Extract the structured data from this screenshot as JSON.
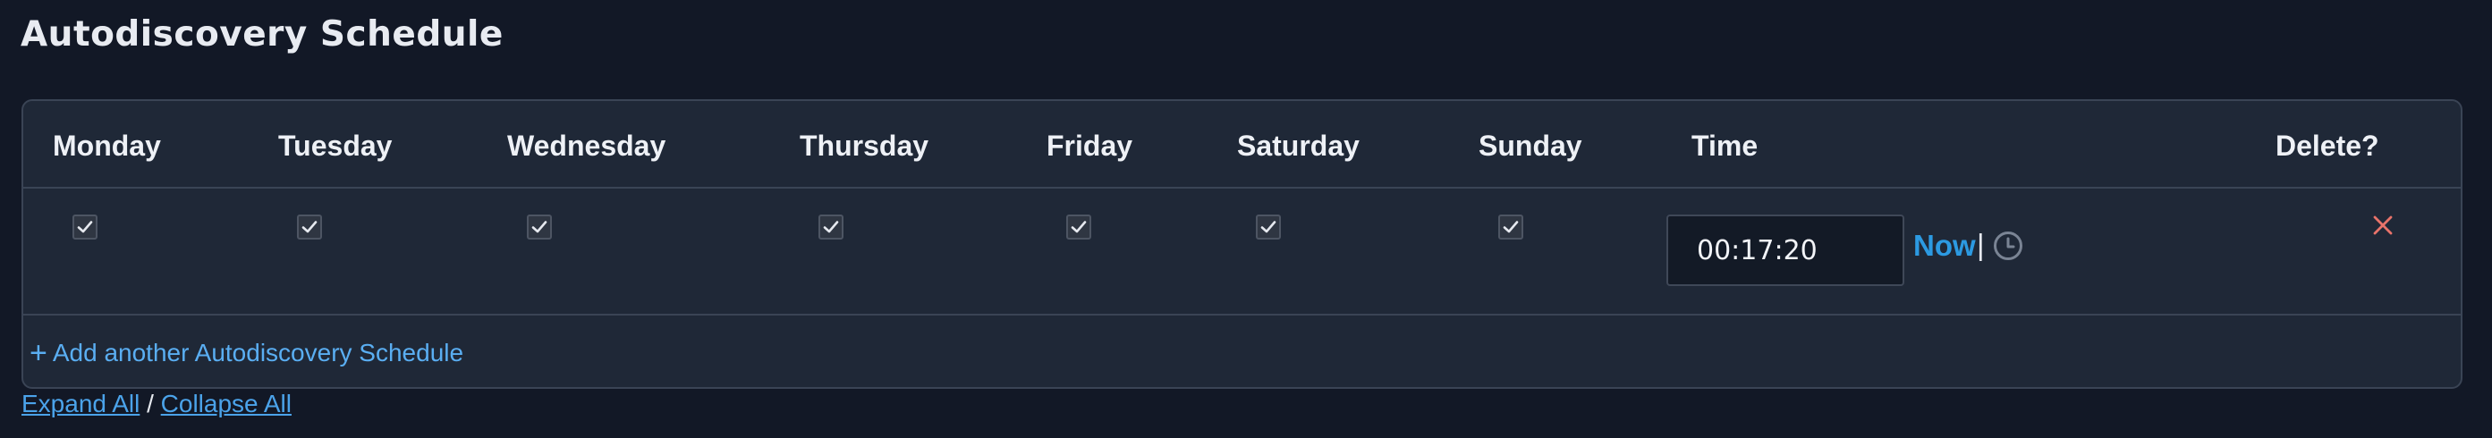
{
  "page": {
    "title": "Autodiscovery Schedule"
  },
  "table": {
    "columns": [
      "Monday",
      "Tuesday",
      "Wednesday",
      "Thursday",
      "Friday",
      "Saturday",
      "Sunday",
      "Time",
      "Delete?"
    ],
    "rows": [
      {
        "days": {
          "monday": true,
          "tuesday": true,
          "wednesday": true,
          "thursday": true,
          "friday": true,
          "saturday": true,
          "sunday": true
        },
        "time_value": "00:17:20",
        "now_label": "Now",
        "separator": "|",
        "clock_icon": "clock-icon",
        "delete_icon": "close-icon"
      }
    ]
  },
  "add_link": {
    "plus": "+",
    "label": "Add another Autodiscovery Schedule"
  },
  "footer": {
    "expand_all": "Expand All",
    "separator": "/",
    "collapse_all": "Collapse All"
  },
  "colors": {
    "background": "#121826",
    "panel": "#1f2837",
    "link": "#2c9ae2",
    "delete": "#e8736a"
  }
}
